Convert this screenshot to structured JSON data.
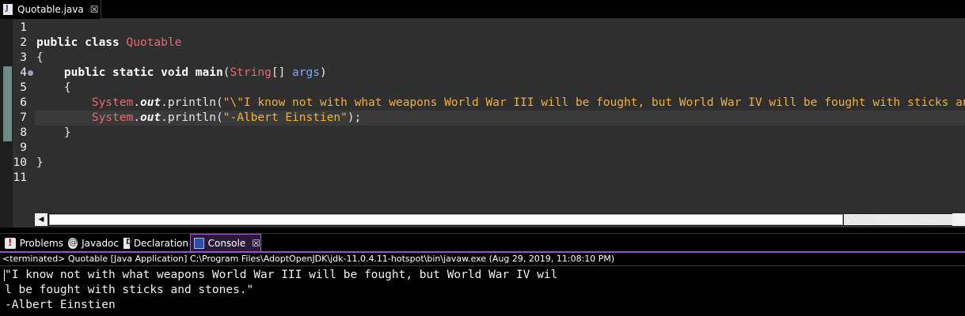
{
  "editor_tab": {
    "filename": "Quotable.java",
    "close_glyph": "☒"
  },
  "code": {
    "line_numbers": [
      "1",
      "2",
      "3",
      "4",
      "5",
      "6",
      "7",
      "8",
      "9",
      "10",
      "11"
    ],
    "lines": [
      [],
      [
        {
          "t": "kw",
          "v": "public class "
        },
        {
          "t": "cls",
          "v": "Quotable"
        }
      ],
      [
        {
          "t": "plain",
          "v": "{"
        }
      ],
      [
        {
          "t": "plain",
          "v": "    "
        },
        {
          "t": "kw",
          "v": "public static void main"
        },
        {
          "t": "plain",
          "v": "("
        },
        {
          "t": "cls",
          "v": "String"
        },
        {
          "t": "plain",
          "v": "[] "
        },
        {
          "t": "param",
          "v": "args"
        },
        {
          "t": "plain",
          "v": ")"
        }
      ],
      [
        {
          "t": "plain",
          "v": "    {"
        }
      ],
      [
        {
          "t": "plain",
          "v": "        "
        },
        {
          "t": "cls",
          "v": "System"
        },
        {
          "t": "plain",
          "v": "."
        },
        {
          "t": "fld",
          "v": "out"
        },
        {
          "t": "plain",
          "v": ".println("
        },
        {
          "t": "str",
          "v": "\"\\\"I know not with what weapons World War III will be fought, but World War IV will be fought with sticks and stones.\\\"\""
        },
        {
          "t": "plain",
          "v": ");"
        }
      ],
      [
        {
          "t": "plain",
          "v": "        "
        },
        {
          "t": "cls",
          "v": "System"
        },
        {
          "t": "plain",
          "v": "."
        },
        {
          "t": "fld",
          "v": "out"
        },
        {
          "t": "plain",
          "v": ".println("
        },
        {
          "t": "str",
          "v": "\"-Albert Einstien\""
        },
        {
          "t": "plain",
          "v": ");"
        }
      ],
      [
        {
          "t": "plain",
          "v": "    }"
        }
      ],
      [],
      [
        {
          "t": "plain",
          "v": "}"
        }
      ],
      []
    ],
    "current_line": 7
  },
  "view_tabs": {
    "problems": "Problems",
    "javadoc": "Javadoc",
    "declaration": "Declaration",
    "console": "Console",
    "close_glyph": "☒"
  },
  "console": {
    "header": "<terminated> Quotable [Java Application] C:\\Program Files\\AdoptOpenJDK\\jdk-11.0.4.11-hotspot\\bin\\javaw.exe (Aug 29, 2019, 11:08:10 PM)",
    "output": [
      "\"I know not with what weapons World War III will be fought, but World War IV wil",
      "l be fought with sticks and stones.\"",
      "-Albert Einstien"
    ]
  },
  "colors": {
    "editor_bg": "#2f2f2f",
    "keyword": "#ffffff",
    "class": "#e06c75",
    "string": "#f1b03b",
    "param": "#7da6ff",
    "console_accent": "#9b4fd0"
  }
}
